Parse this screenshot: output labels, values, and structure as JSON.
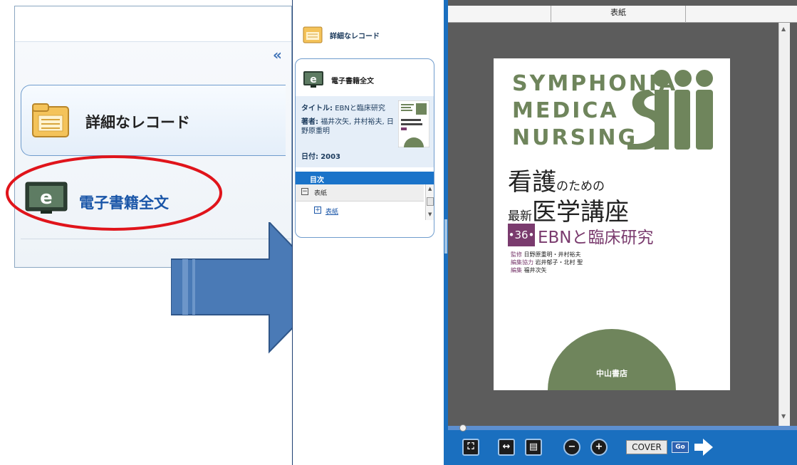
{
  "zoom_panel": {
    "collapse_glyph": "«",
    "detailed_record_label": "詳細なレコード",
    "ebook_fulltext_label": "電子書籍全文"
  },
  "sidebar": {
    "detailed_record_label": "詳細なレコード",
    "ebook_fulltext_label": "電子書籍全文",
    "meta": {
      "title_label": "タイトル:",
      "title_value": "EBNと臨床研究",
      "author_label": "著者:",
      "author_value": "福井次矢, 井村裕夫, 日野原重明",
      "date_label": "日付:",
      "date_value": "2003"
    },
    "toc_header": "目次",
    "toc_items": [
      {
        "label": "表紙",
        "toggle": "−"
      },
      {
        "label": "表紙",
        "toggle": "+"
      }
    ]
  },
  "viewer": {
    "header_title": "表紙",
    "cover": {
      "series_lines": [
        "SYMPHONIA",
        "MEDICA",
        "NURSING"
      ],
      "logo_text": "smn",
      "title_line1_big": "看護",
      "title_line1_small": "のための",
      "title_line2_small": "最新",
      "title_line2_big": "医学講座",
      "volume_badge": "•36•",
      "subtitle": "EBNと臨床研究",
      "credits": [
        {
          "role": "監修",
          "names": "日野原重明・井村裕夫"
        },
        {
          "role": "編集協力",
          "names": "岩井郁子・北村 聖"
        },
        {
          "role": "編集",
          "names": "福井次矢"
        }
      ],
      "publisher": "中山書店"
    },
    "toolbar": {
      "cover_label": "COVER",
      "go_label": "Go"
    }
  },
  "colors": {
    "accent_blue": "#1a6fbf",
    "highlight_red": "#e0141b",
    "arrow_blue": "#4a7ab6",
    "cover_green": "#6f855c",
    "cover_purple": "#7a3b6e"
  }
}
